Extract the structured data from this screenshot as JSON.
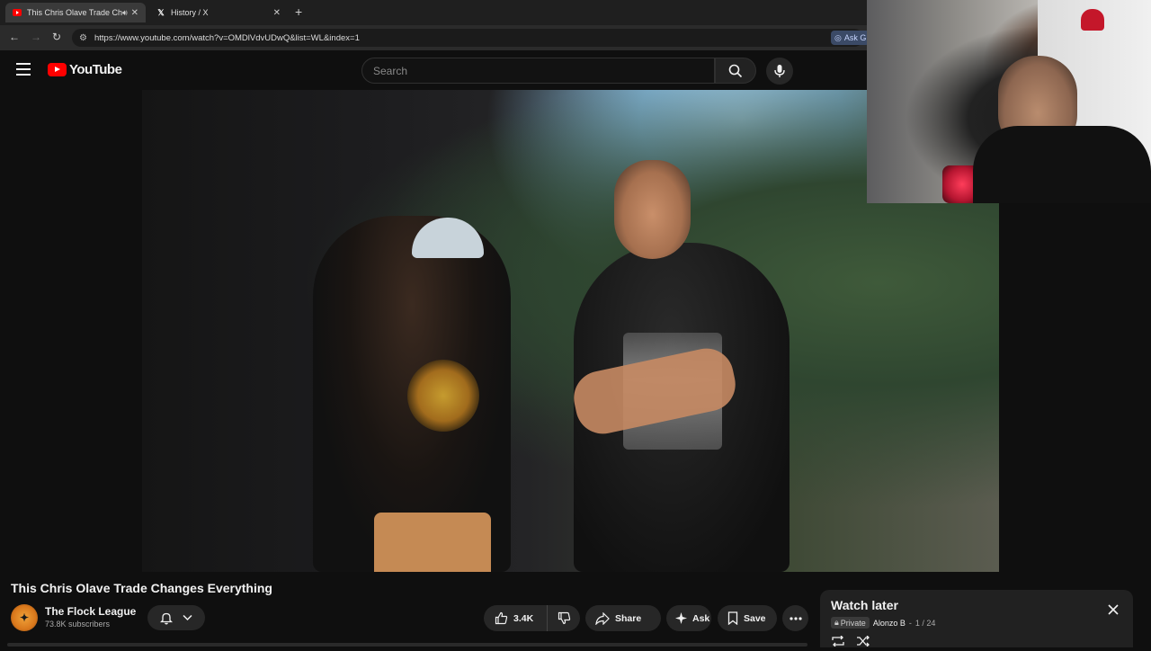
{
  "browser": {
    "tabs": [
      {
        "title": "This Chris Olave Trade Changes Everything",
        "favicon": "youtube-favicon",
        "active": true,
        "audio": true
      },
      {
        "title": "History / X",
        "favicon": "x-favicon",
        "active": false
      }
    ],
    "url": "https://www.youtube.com/watch?v=OMDlVdvUDwQ&list=WL&index=1",
    "ask_button": "Ask G"
  },
  "youtube": {
    "logo_text": "YouTube",
    "search_placeholder": "Search"
  },
  "video": {
    "title": "This Chris Olave Trade Changes Everything",
    "channel": "The Flock League",
    "subscribers": "73.8K subscribers",
    "likes": "3.4K",
    "share_label": "Share",
    "ask_label": "Ask",
    "save_label": "Save"
  },
  "playlist": {
    "title": "Watch later",
    "privacy": "Private",
    "owner": "Alonzo B",
    "position": "1 / 24"
  },
  "colors": {
    "brand_red": "#ff0000",
    "background": "#0f0f0f",
    "pill": "#272727"
  }
}
